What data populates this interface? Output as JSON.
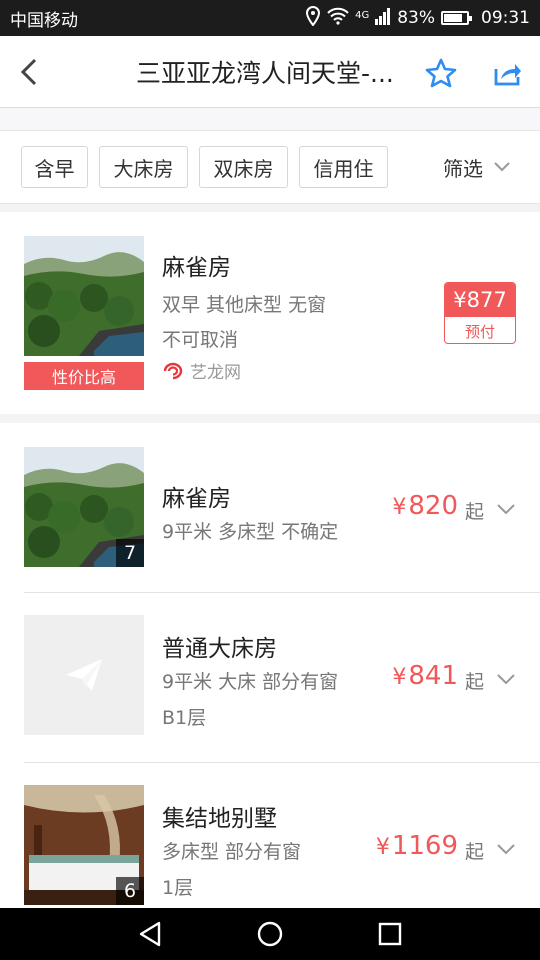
{
  "status_bar": {
    "carrier": "中国移动",
    "network": "4G",
    "battery": "83%",
    "battery_fraction": 0.83,
    "time": "09:31"
  },
  "header": {
    "title": "三亚亚龙湾人间天堂-..."
  },
  "filters": {
    "chips": [
      "含早",
      "大床房",
      "双床房",
      "信用住"
    ],
    "filter_label": "筛选"
  },
  "featured": {
    "room_name": "麻雀房",
    "detail": "双早 其他床型 无窗",
    "cancel_policy": "不可取消",
    "source": "艺龙网",
    "badge": "性价比高",
    "price": "¥877",
    "pay_type": "预付"
  },
  "rooms": [
    {
      "name": "麻雀房",
      "detail": "9平米 多床型 不确定",
      "extra": "",
      "currency": "¥",
      "price": "820",
      "suffix": "起",
      "photo_count": "7"
    },
    {
      "name": "普通大床房",
      "detail": "9平米 大床 部分有窗",
      "extra": "B1层",
      "currency": "¥",
      "price": "841",
      "suffix": "起",
      "photo_count": ""
    },
    {
      "name": "集结地别墅",
      "detail": "多床型 部分有窗",
      "extra": "1层",
      "currency": "¥",
      "price": "1169",
      "suffix": "起",
      "photo_count": "6"
    }
  ],
  "colors": {
    "accent": "#f0585a",
    "icon_blue": "#2f8cf0"
  }
}
